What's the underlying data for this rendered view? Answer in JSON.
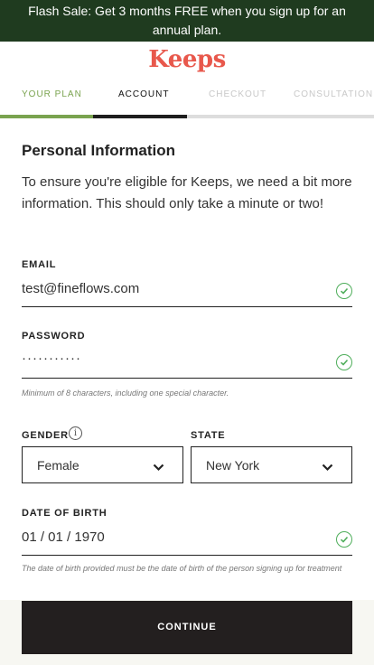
{
  "banner": {
    "text": "Flash Sale: Get 3 months FREE when you sign up for an annual plan."
  },
  "brand": {
    "logo": "Keeps",
    "color": "#e8584c"
  },
  "steps": [
    {
      "label": "YOUR PLAN",
      "state": "complete"
    },
    {
      "label": "ACCOUNT",
      "state": "active"
    },
    {
      "label": "CHECKOUT",
      "state": "inactive"
    },
    {
      "label": "CONSULTATION",
      "state": "inactive"
    }
  ],
  "form": {
    "title": "Personal Information",
    "intro": "To ensure you're eligible for Keeps, we need a bit more information. This should only take a minute or two!",
    "email": {
      "label": "EMAIL",
      "value": "test@fineflows.com",
      "valid": true
    },
    "password": {
      "label": "PASSWORD",
      "value": "···········",
      "valid": true,
      "hint": "Minimum of 8 characters, including one special character."
    },
    "gender": {
      "label": "GENDER",
      "value": "Female",
      "icon": "info-icon"
    },
    "state": {
      "label": "STATE",
      "value": "New York"
    },
    "dob": {
      "label": "DATE OF BIRTH",
      "value": "01 / 01 / 1970",
      "valid": true,
      "hint": "The date of birth provided must be the date of birth of the person signing up for treatment"
    }
  },
  "actions": {
    "continue_label": "CONTINUE"
  },
  "colors": {
    "banner_bg": "#1f3b1f",
    "progress_done": "#7aa34f",
    "progress_active": "#1e1e1e",
    "valid_green": "#4fae5b",
    "button_bg": "#231f1f"
  }
}
